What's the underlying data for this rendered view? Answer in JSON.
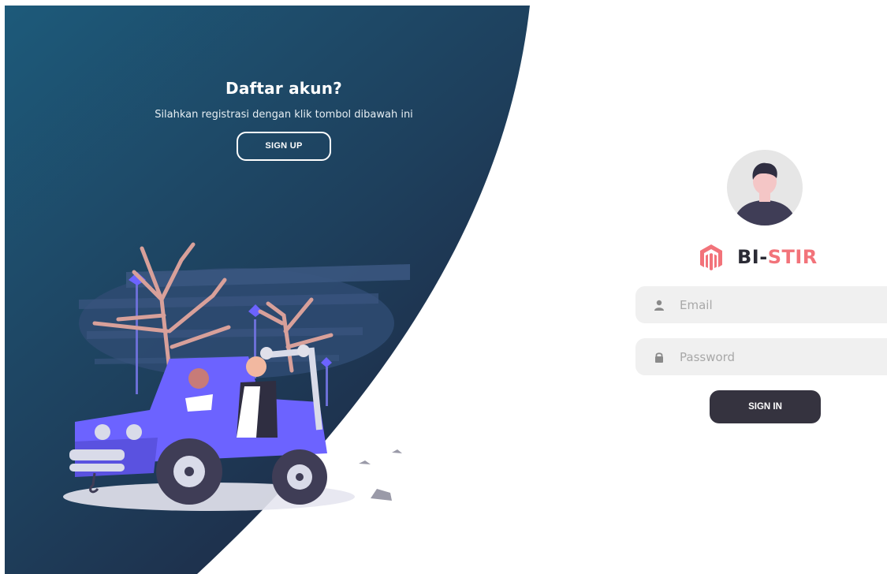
{
  "left_panel": {
    "title": "Daftar akun?",
    "subtitle": "Silahkan registrasi dengan klik tombol dibawah ini",
    "signup_label": "SIGN UP"
  },
  "brand": {
    "name_part1": "BI-",
    "name_part2": "STIR",
    "logo_icon": "magento-logo-icon"
  },
  "form": {
    "email_placeholder": "Email",
    "email_value": "",
    "email_icon": "user-icon",
    "password_placeholder": "Password",
    "password_value": "",
    "password_icon": "lock-icon",
    "signin_label": "SIGN IN"
  },
  "colors": {
    "panel_gradient_start": "#1d5a7a",
    "panel_gradient_end": "#1e2540",
    "brand_dark": "#2b2b35",
    "brand_accent": "#f2737a",
    "button_dark": "#35333f",
    "input_bg": "#f0f0f0"
  }
}
